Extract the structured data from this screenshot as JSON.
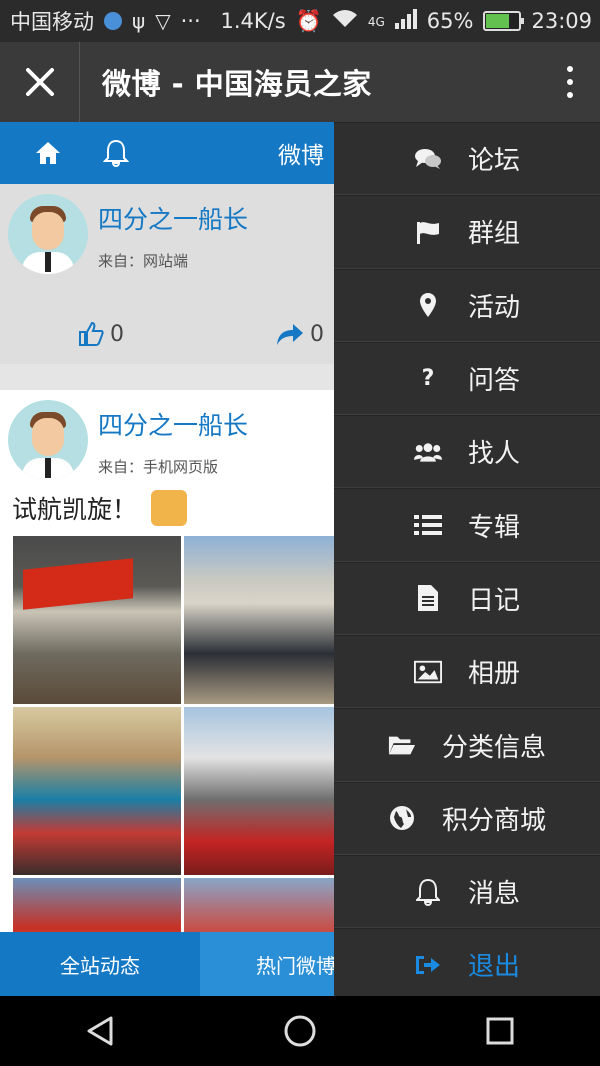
{
  "status": {
    "carrier": "中国移动",
    "speed": "1.4K/s",
    "network": "4G",
    "battery": "65%",
    "battery_level": 0.65,
    "time": "23:09"
  },
  "appbar": {
    "title": "微博 - 中国海员之家"
  },
  "feed": {
    "brand": "微博",
    "posts": [
      {
        "author": "四分之一船长",
        "source": "来自：网站端",
        "likes": "0",
        "shares": "0"
      },
      {
        "author": "四分之一船长",
        "source": "来自：手机网页版",
        "text": "试航凯旋！"
      }
    ],
    "tabs": {
      "active": "全站动态",
      "other": "热门微博"
    }
  },
  "menu": {
    "items": [
      {
        "label": "论坛",
        "icon": "comments-icon"
      },
      {
        "label": "群组",
        "icon": "flag-icon"
      },
      {
        "label": "活动",
        "icon": "map-marker-icon"
      },
      {
        "label": "问答",
        "icon": "question-icon"
      },
      {
        "label": "找人",
        "icon": "users-icon"
      },
      {
        "label": "专辑",
        "icon": "list-icon"
      },
      {
        "label": "日记",
        "icon": "file-text-icon"
      },
      {
        "label": "相册",
        "icon": "image-icon"
      },
      {
        "label": "分类信息",
        "icon": "folder-open-icon"
      },
      {
        "label": "积分商城",
        "icon": "globe-icon"
      },
      {
        "label": "消息",
        "icon": "bell-icon"
      },
      {
        "label": "退出",
        "icon": "sign-out-icon"
      }
    ]
  },
  "colors": {
    "accent": "#1478c4",
    "menu_bg": "#2f2f2f",
    "logout": "#1a8be0"
  }
}
